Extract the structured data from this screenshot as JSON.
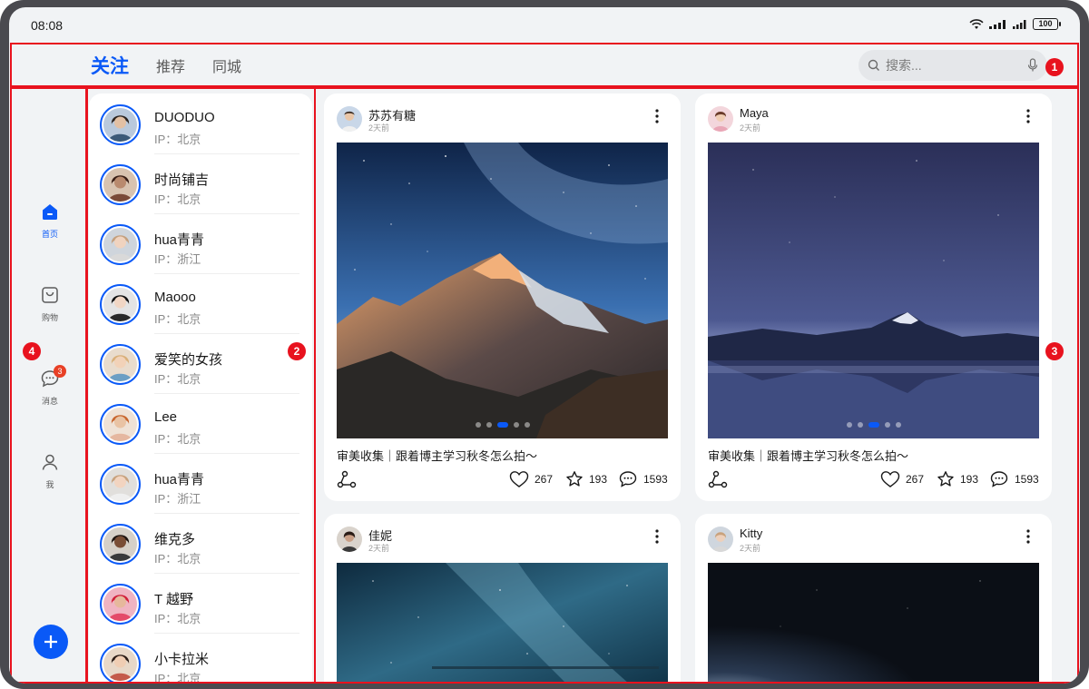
{
  "status_bar": {
    "time": "08:08",
    "battery": "100"
  },
  "top_tabs": [
    {
      "label": "关注",
      "active": true
    },
    {
      "label": "推荐",
      "active": false
    },
    {
      "label": "同城",
      "active": false
    }
  ],
  "search": {
    "placeholder": "搜索..."
  },
  "side_nav": [
    {
      "label": "首页",
      "icon": "home-icon",
      "active": true
    },
    {
      "label": "购物",
      "icon": "shopping-bag-icon",
      "active": false
    },
    {
      "label": "消息",
      "icon": "message-icon",
      "active": false,
      "badge": "3"
    },
    {
      "label": "我",
      "icon": "person-icon",
      "active": false
    }
  ],
  "region_markers": [
    "1",
    "2",
    "3",
    "4"
  ],
  "follow_list": [
    {
      "name": "DUODUO",
      "ip": "IP：北京"
    },
    {
      "name": "时尚铺吉",
      "ip": "IP：北京"
    },
    {
      "name": "hua青青",
      "ip": "IP：浙江"
    },
    {
      "name": "Maooo",
      "ip": "IP：北京"
    },
    {
      "name": "爱笑的女孩",
      "ip": "IP：北京"
    },
    {
      "name": "Lee",
      "ip": "IP：北京"
    },
    {
      "name": "hua青青",
      "ip": "IP：浙江"
    },
    {
      "name": "维克多",
      "ip": "IP：北京"
    },
    {
      "name": "T 越野",
      "ip": "IP：北京"
    },
    {
      "name": "小卡拉米",
      "ip": "IP：北京"
    }
  ],
  "feed": [
    {
      "author": "苏苏有糖",
      "time": "2天前",
      "caption": "审美收集｜跟着博主学习秋冬怎么拍～",
      "likes": "267",
      "favorites": "193",
      "comments": "1593",
      "image": "mountain-milky-way"
    },
    {
      "author": "Maya",
      "time": "2天前",
      "caption": "审美收集｜跟着博主学习秋冬怎么拍～",
      "likes": "267",
      "favorites": "193",
      "comments": "1593",
      "image": "lake-mountain-dusk"
    },
    {
      "author": "佳妮",
      "time": "2天前",
      "image": "starry-sky"
    },
    {
      "author": "Kitty",
      "time": "2天前",
      "image": "night-sky-dark"
    }
  ],
  "colors": {
    "accent": "#0a59f7",
    "highlight": "#e8121e",
    "background": "#f1f3f5"
  }
}
